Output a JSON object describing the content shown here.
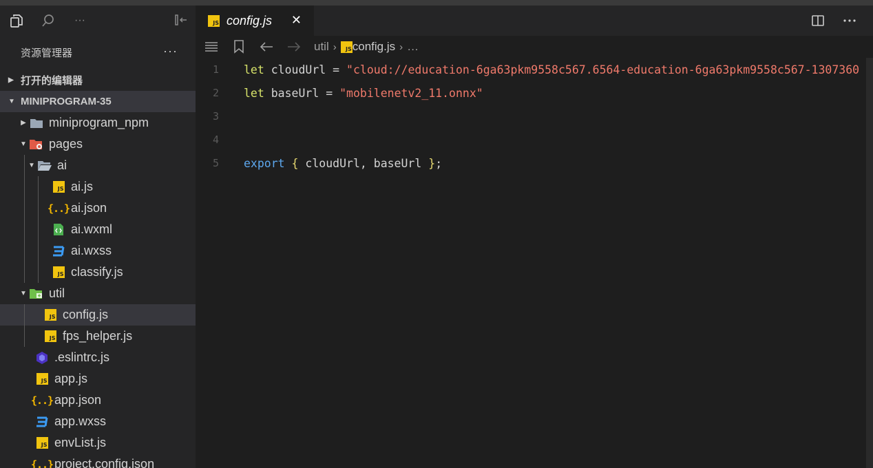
{
  "sidebar": {
    "toolbar": {
      "icons": [
        "files-icon",
        "search-icon",
        "more-icon",
        "collapse-panel-icon"
      ],
      "more_label": "···"
    },
    "header": {
      "title": "资源管理器",
      "more": "···"
    },
    "open_editors": {
      "label": "打开的编辑器"
    },
    "project": {
      "label": "MINIPROGRAM-35"
    },
    "tree": [
      {
        "name": "miniprogram_npm",
        "type": "folder",
        "icon": "folder-icon"
      },
      {
        "name": "pages",
        "type": "folder-open",
        "icon": "pages-folder-icon"
      },
      {
        "name": "ai",
        "type": "folder-open",
        "icon": "folder-open-icon"
      },
      {
        "name": "ai.js",
        "type": "js",
        "icon": "js-file-icon"
      },
      {
        "name": "ai.json",
        "type": "json",
        "icon": "json-file-icon"
      },
      {
        "name": "ai.wxml",
        "type": "wxml",
        "icon": "wxml-file-icon"
      },
      {
        "name": "ai.wxss",
        "type": "css",
        "icon": "wxss-file-icon"
      },
      {
        "name": "classify.js",
        "type": "js",
        "icon": "js-file-icon"
      },
      {
        "name": "util",
        "type": "folder-open",
        "icon": "util-folder-icon"
      },
      {
        "name": "config.js",
        "type": "js",
        "icon": "js-file-icon",
        "selected": true
      },
      {
        "name": "fps_helper.js",
        "type": "js",
        "icon": "js-file-icon"
      },
      {
        "name": ".eslintrc.js",
        "type": "eslint",
        "icon": "eslint-file-icon"
      },
      {
        "name": "app.js",
        "type": "js",
        "icon": "js-file-icon"
      },
      {
        "name": "app.json",
        "type": "json",
        "icon": "json-file-icon"
      },
      {
        "name": "app.wxss",
        "type": "css",
        "icon": "wxss-file-icon"
      },
      {
        "name": "envList.js",
        "type": "js",
        "icon": "js-file-icon"
      },
      {
        "name": "project.config.json",
        "type": "json",
        "icon": "json-file-icon"
      }
    ]
  },
  "editor": {
    "tab": {
      "label": "config.js",
      "close": "✕",
      "badge": "JS"
    },
    "breadcrumbs": {
      "folder": "util",
      "file": "config.js",
      "ellipsis": "…"
    },
    "lines": [
      {
        "num": "1",
        "kw": "let",
        "name": "cloudUrl",
        "eq": "=",
        "value": "\"cloud://education-6ga63pkm9558c567.6564-education-6ga63pkm9558c567-1307360"
      },
      {
        "num": "2",
        "kw": "let",
        "name": "baseUrl",
        "eq": "=",
        "value": "\"mobilenetv2_11.onnx\""
      },
      {
        "num": "3"
      },
      {
        "num": "4"
      },
      {
        "num": "5",
        "kw": "export",
        "open": "{",
        "names": "cloudUrl, baseUrl",
        "close": "}",
        "end": ";"
      }
    ]
  },
  "colors": {
    "keyword_let": "#d7e36a",
    "keyword_export": "#5da8ef",
    "string": "#f07a6b",
    "js_badge": "#f1c40f",
    "selection": "#37373d"
  }
}
